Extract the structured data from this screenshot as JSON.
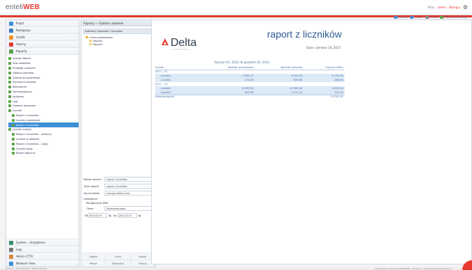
{
  "app": {
    "logo_text": "enteli",
    "logo_accent": "WEB",
    "user_label": "Witaj",
    "user_link": "admin  ·  Wyloguj"
  },
  "colors": {
    "accent": "#e23a2f",
    "primary": "#3d8fd6",
    "report_blue": "#2c5a96"
  },
  "sidebar": {
    "top_items": [
      {
        "label": "Pulpit",
        "icon": "desktop-icon",
        "color": "#3d8fd6"
      },
      {
        "label": "Nawigacja",
        "icon": "navigation-icon",
        "color": "#3b7bbf"
      },
      {
        "label": "Grafiki",
        "icon": "graphics-icon",
        "color": "#e8922e"
      },
      {
        "label": "Alarmy",
        "icon": "alarm-icon",
        "color": "#e23a2f"
      },
      {
        "label": "Raporty",
        "icon": "reports-icon",
        "color": "#5aa34a"
      }
    ],
    "tree": [
      "System Report",
      "Stan obiektów",
      "Przegląd urządzeń",
      "Historia alarmów",
      "Zdarzenia systemowe",
      "Archiwum trendów",
      "Kalendarze",
      "Harmonogramy",
      "Aplikacje",
      "Logi",
      "Zadania okresowe",
      "Liczniki",
      "Raport z liczników",
      "Liczniki miesięczne",
      "Raport z liczników",
      "Liczniki energii",
      "Raport z liczników – zbiorczy",
      "Liczniki w obiekcie",
      "Raport z liczników – nowy",
      "Liczniki wody",
      "Raport zbiorczy"
    ],
    "selected_index": 14,
    "bottom_items": [
      {
        "label": "System – Urządzenia",
        "icon": "devices-icon",
        "color": "#3a8e6a"
      },
      {
        "label": "Logi",
        "icon": "log-icon",
        "color": "#777"
      },
      {
        "label": "Admin CTTV",
        "icon": "admin-icon",
        "color": "#d6883a"
      },
      {
        "label": "Network View",
        "icon": "network-icon",
        "color": "#3d8fd6"
      }
    ]
  },
  "midpanel": {
    "header": "Raporty ― Szablon ustawień",
    "sub_header": "Szablony raportów z liczników",
    "tree": [
      {
        "label": "Grupa podstawowa",
        "child": false
      },
      {
        "label": "Raport1",
        "child": true
      },
      {
        "label": "Raport2",
        "child": true
      }
    ],
    "form": {
      "name_label": "Nazwa raportu",
      "name_value": "raport z liczników",
      "title_label": "Tytuł raportu",
      "title_value": "raport z liczników",
      "type_label": "Typ liczników",
      "type_value": "energia elektryczna",
      "section_label": "Ustawienia",
      "config_label": "Konfiguracja BMS",
      "period_label": "Okres",
      "period_value": "Niestandardowy",
      "from_label": "Od",
      "from_value": "2012-01-01",
      "to_label": "Do",
      "to_value": "2012-12-31"
    },
    "bottom": [
      [
        "Zapisz",
        "Usuń",
        "Kopiuj"
      ],
      [
        "Pokaż",
        "Eksportuj",
        "Drukuj"
      ]
    ]
  },
  "report": {
    "toolbar": [
      {
        "label": "Zamknij",
        "color": "#3d8fd6"
      },
      {
        "label": "Zapisz",
        "color": "#3d8fd6"
      },
      {
        "label": "Drukuj",
        "color": "#888"
      },
      {
        "label": "Eksportuj do Excela",
        "color": "#5aa34a"
      }
    ],
    "brand": "Delta",
    "brand_tag": "CONTROLS",
    "title": "raport z liczników",
    "date": "Data: czerwiec 18, 2015",
    "period": "Styczeń 01, 2012 do grudzień 31, 2012",
    "columns": [
      "Licznik",
      "Wartość początkowa",
      "Wartość końcowa",
      "Zużycie (kWh)"
    ],
    "rows": [
      {
        "kind": "grp",
        "cells": [
          "2011 – 01",
          "",
          "",
          ""
        ]
      },
      {
        "kind": "row",
        "cells": [
          "Licznik1",
          "1 599,15",
          "8 552,50",
          "6 953,35"
        ]
      },
      {
        "kind": "row",
        "cells": [
          "Licznik2",
          "175,00",
          "659,60",
          "484,60"
        ]
      },
      {
        "kind": "grp",
        "cells": [
          "2011 – 02",
          "",
          "",
          ""
        ]
      },
      {
        "kind": "row",
        "cells": [
          "Licznik1",
          "8 552,50",
          "12 355,50",
          "3 803,00"
        ]
      },
      {
        "kind": "row",
        "cells": [
          "Licznik2",
          "659,60",
          "1 011,10",
          "351,50"
        ]
      },
      {
        "kind": "sum",
        "cells": [
          "Podsumowanie",
          "",
          "",
          "11 592,45"
        ]
      }
    ]
  },
  "status": {
    "left": "Gotowe  ·  Administrator  ·  Delta Controls",
    "right": "Połączenie z serwerem enteliWEB  ·  aktywne  ·  ostatnia aktualizacja 18:42"
  }
}
